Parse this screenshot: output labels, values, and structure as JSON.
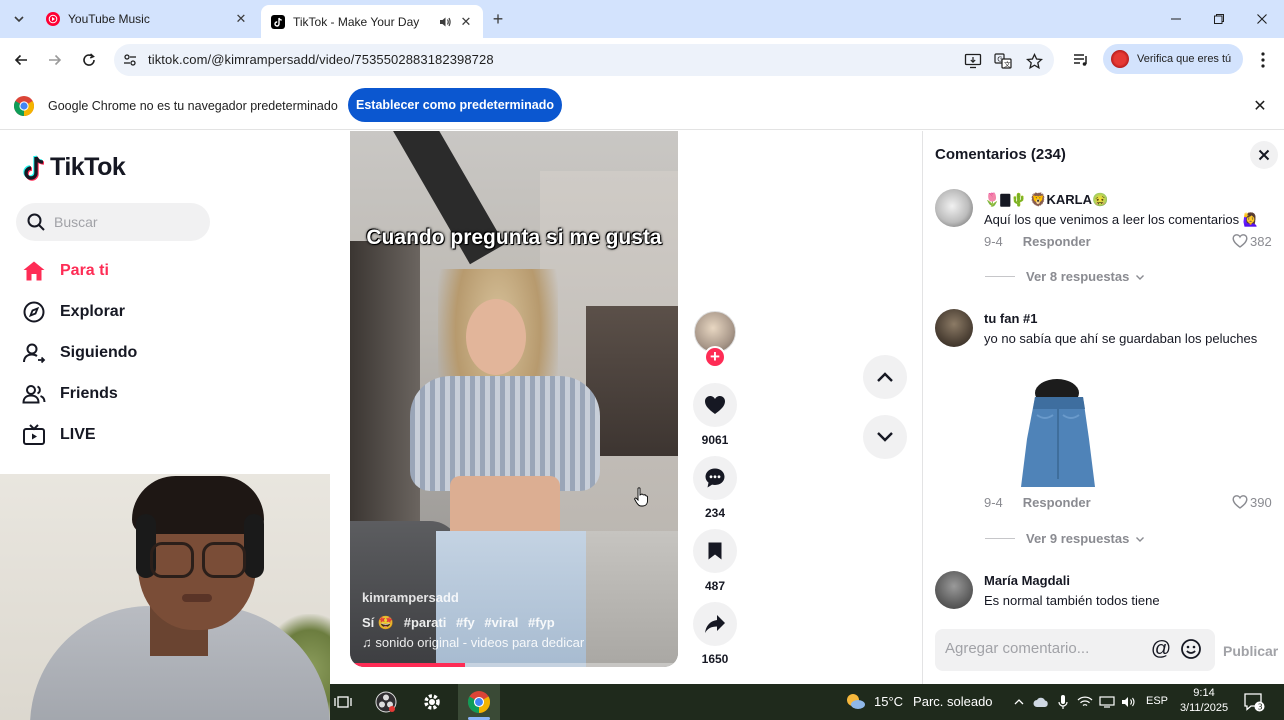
{
  "browser": {
    "tabs": [
      {
        "label": "YouTube Music",
        "favicon": "youtube-music-icon",
        "active": false
      },
      {
        "label": "TikTok - Make Your Day",
        "favicon": "tiktok-icon",
        "active": true
      }
    ],
    "url": "tiktok.com/@kimrampersadd/video/7535502883182398728",
    "profile_label": "Verifica que eres tú",
    "infobar": {
      "message": "Google Chrome no es tu navegador predeterminado",
      "button": "Establecer como predeterminado"
    }
  },
  "tiktok": {
    "logo_text": "TikTok",
    "search_placeholder": "Buscar",
    "nav": [
      {
        "label": "Para ti",
        "icon": "home-icon",
        "active": true
      },
      {
        "label": "Explorar",
        "icon": "compass-icon",
        "active": false
      },
      {
        "label": "Siguiendo",
        "icon": "user-follow-icon",
        "active": false
      },
      {
        "label": "Friends",
        "icon": "friends-icon",
        "active": false
      },
      {
        "label": "LIVE",
        "icon": "live-icon",
        "active": false
      }
    ],
    "video": {
      "caption_overlay": "Cuando pregunta si me gusta",
      "author": "kimrampersadd",
      "description_start": "Sí 🤩",
      "hashtags": [
        "#parati",
        "#fy",
        "#viral",
        "#fyp"
      ],
      "sound": "♫ sonido original - videos para dedicar",
      "progress": 0.35
    },
    "actions": {
      "likes": "9061",
      "comments": "234",
      "saves": "487",
      "shares": "1650"
    },
    "comments_panel": {
      "title": "Comentarios (234)",
      "comments": [
        {
          "name": "🌷🀫🌵 🦁KARLA🤢",
          "text": "Aquí los que venimos a leer los comentarios 🙋‍♀️",
          "date": "9-4",
          "reply": "Responder",
          "likes": "382",
          "more_replies": "Ver 8 respuestas"
        },
        {
          "name": "tu fan #1",
          "text": "yo no sabía que ahí se guardaban los peluches",
          "date": "9-4",
          "reply": "Responder",
          "likes": "390",
          "more_replies": "Ver 9 respuestas"
        },
        {
          "name": "María Magdali",
          "text": "Es normal también todos tiene"
        }
      ],
      "input_placeholder": "Agregar comentario...",
      "post_label": "Publicar"
    }
  },
  "taskbar": {
    "weather_temp": "15°C",
    "weather_condition": "Parc. soleado",
    "language": "ESP",
    "time": "9:14",
    "date": "3/11/2025",
    "notifications": "3"
  }
}
